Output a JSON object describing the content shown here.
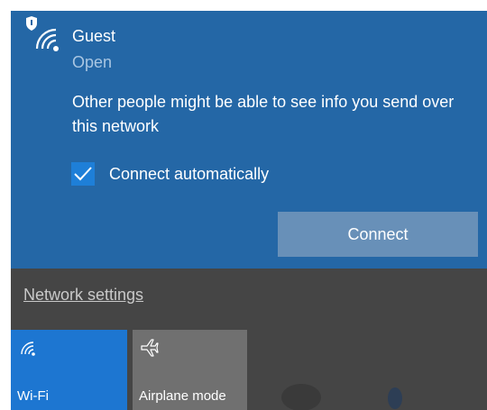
{
  "network": {
    "name": "Guest",
    "status": "Open",
    "warning": "Other people might be able to see info you send over this network",
    "connect_automatically_label": "Connect automatically",
    "connect_automatically_checked": true,
    "connect_label": "Connect"
  },
  "settings": {
    "link_label": "Network settings"
  },
  "quick_actions": [
    {
      "label": "Wi-Fi",
      "icon": "wifi-icon",
      "active": true
    },
    {
      "label": "Airplane mode",
      "icon": "airplane-icon",
      "active": false
    }
  ],
  "colors": {
    "card_blue": "#2467a6",
    "panel_gray": "#454545",
    "accent_blue": "#1d76d1",
    "connect_button": "#6890b8",
    "tile_inactive": "#707070"
  }
}
